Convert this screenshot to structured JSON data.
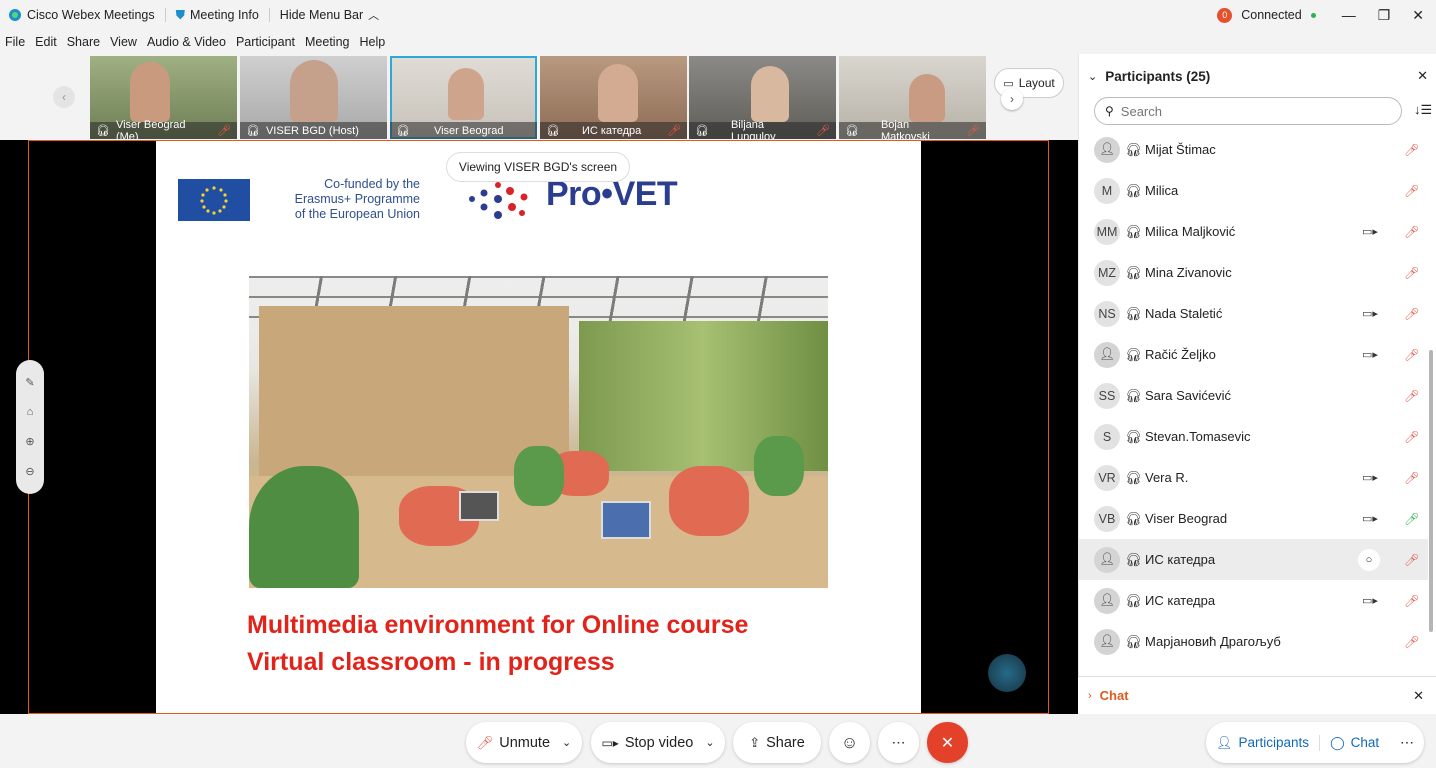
{
  "titlebar": {
    "app_name": "Cisco Webex Meetings",
    "meeting_info": "Meeting Info",
    "hide_menu": "Hide Menu Bar",
    "connected": "Connected",
    "badge": "0"
  },
  "menu": [
    "File",
    "Edit",
    "Share",
    "View",
    "Audio & Video",
    "Participant",
    "Meeting",
    "Help"
  ],
  "filmstrip": {
    "layout_label": "Layout",
    "tiles": [
      {
        "name": "Viser Beograd (Me)",
        "muted": true
      },
      {
        "name": "VISER BGD (Host)",
        "muted": false
      },
      {
        "name": "Viser Beograd",
        "muted": false
      },
      {
        "name": "ИС катедра",
        "muted": true
      },
      {
        "name": "Biljana Lungulov",
        "muted": true
      },
      {
        "name": "Bojan Matkovski",
        "muted": true
      }
    ]
  },
  "share": {
    "banner": "Viewing VISER BGD's screen",
    "eu_text": [
      "Co-funded by the",
      "Erasmus+ Programme",
      "of the European Union"
    ],
    "logo_text": "Pro•VET",
    "heading1": "Multimedia environment for Online course",
    "heading2": "Virtual classroom - in progress"
  },
  "panel": {
    "title": "Participants (25)",
    "search_placeholder": "Search",
    "chat_label": "Chat",
    "participants": [
      {
        "initials": "",
        "name": "Mijat Štimac",
        "video": false,
        "mic": "muted"
      },
      {
        "initials": "M",
        "name": "Milica",
        "video": false,
        "mic": "muted"
      },
      {
        "initials": "MM",
        "name": "Milica Maljković",
        "video": true,
        "mic": "muted"
      },
      {
        "initials": "MZ",
        "name": "Mina Zivanovic",
        "video": false,
        "mic": "muted"
      },
      {
        "initials": "NS",
        "name": "Nada Staletić",
        "video": true,
        "mic": "muted"
      },
      {
        "initials": "",
        "name": "Račić Željko",
        "video": true,
        "mic": "muted"
      },
      {
        "initials": "SS",
        "name": "Sara Savićević",
        "video": false,
        "mic": "muted"
      },
      {
        "initials": "S",
        "name": "Stevan.Tomasevic",
        "video": false,
        "mic": "muted"
      },
      {
        "initials": "VR",
        "name": "Vera R.",
        "video": true,
        "mic": "muted"
      },
      {
        "initials": "VB",
        "name": "Viser Beograd",
        "video": true,
        "mic": "on"
      },
      {
        "initials": "",
        "name": "ИС катедра",
        "video": false,
        "mic": "muted",
        "chat": true
      },
      {
        "initials": "",
        "name": "ИС катедра",
        "video": true,
        "mic": "muted"
      },
      {
        "initials": "",
        "name": "Марјановић Драгољуб",
        "video": false,
        "mic": "muted"
      }
    ]
  },
  "controls": {
    "unmute": "Unmute",
    "stop_video": "Stop video",
    "share": "Share",
    "participants": "Participants",
    "chat": "Chat"
  }
}
